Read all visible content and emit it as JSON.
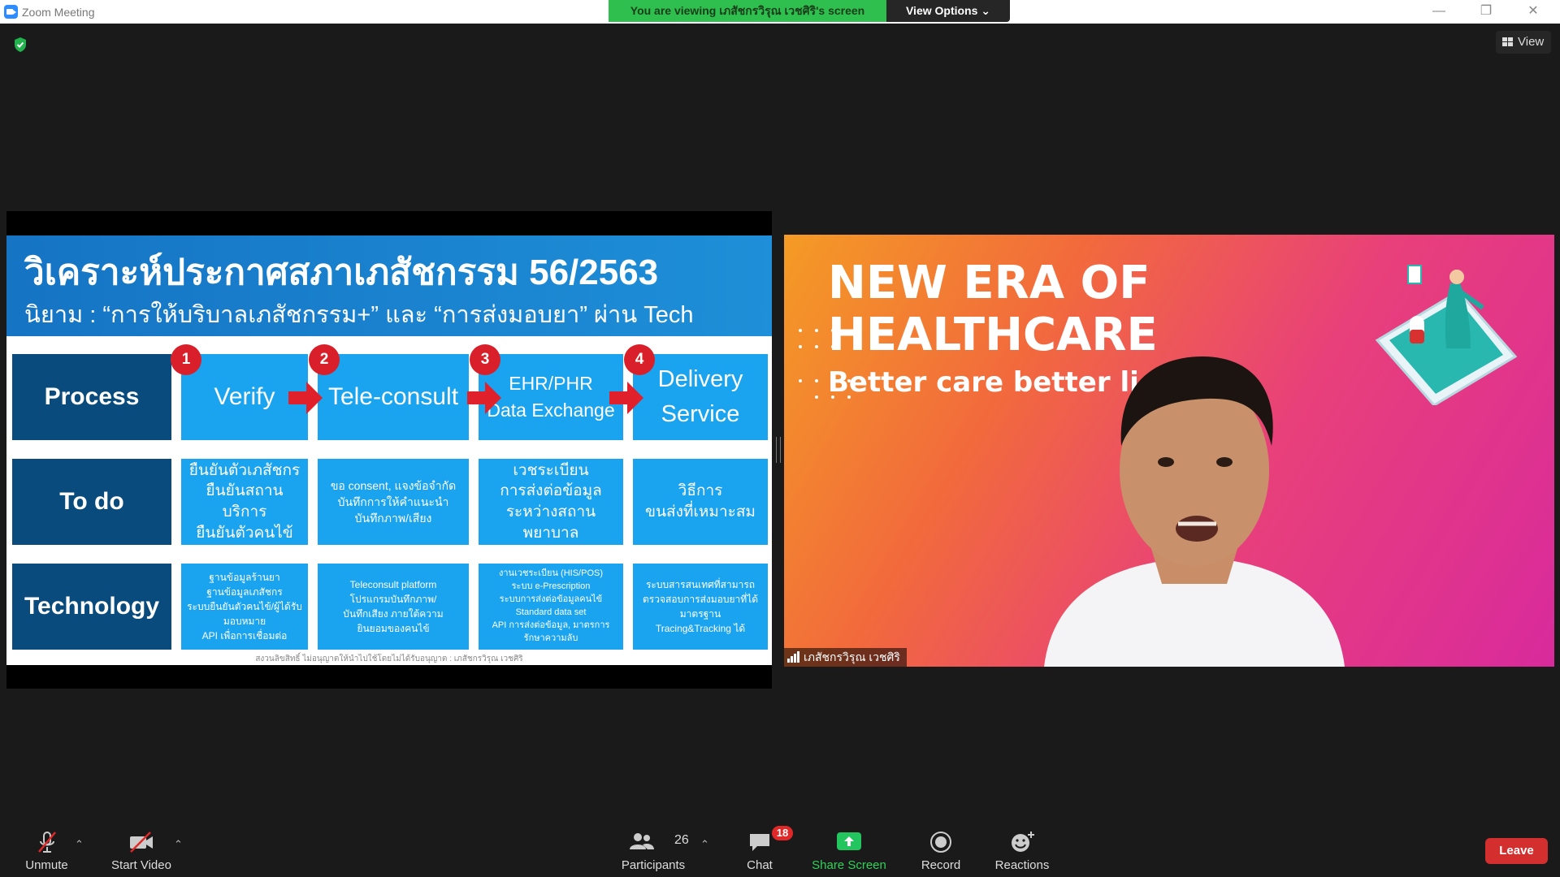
{
  "window": {
    "title": "Zoom Meeting",
    "viewing_banner": "You are viewing เภสัชกรวิรุณ เวชศิริ's screen",
    "view_options": "View Options ⌄",
    "view_button": "View"
  },
  "slide": {
    "title": "วิเคราะห์ประกาศสภาเภสัชกรรม 56/2563",
    "subtitle": "นิยาม : “การให้บริบาลเภสัชกรรม+” และ “การส่งมอบยา” ผ่าน Tech",
    "rows": {
      "process": "Process",
      "todo": "To do",
      "technology": "Technology"
    },
    "steps": [
      {
        "num": "1",
        "label": "Verify"
      },
      {
        "num": "2",
        "label": "Tele-consult"
      },
      {
        "num": "3",
        "label_line1": "EHR/PHR",
        "label_line2": "Data Exchange"
      },
      {
        "num": "4",
        "label_line1": "Delivery",
        "label_line2": "Service"
      }
    ],
    "todo": [
      [
        "ยืนยันตัวเภสัชกร",
        "ยืนยันสถานบริการ",
        "ยืนยันตัวคนไข้"
      ],
      [
        "ขอ consent, แจงข้อจำกัด",
        "บันทึกการให้คำแนะนำ",
        "บันทึกภาพ/เสียง"
      ],
      [
        "เวชระเบียน",
        "การส่งต่อข้อมูล",
        "ระหว่างสถานพยาบาล"
      ],
      [
        "วิธีการ",
        "ขนส่งที่เหมาะสม"
      ]
    ],
    "technology": [
      [
        "ฐานข้อมูลร้านยา",
        "ฐานข้อมูลเภสัชกร",
        "ระบบยืนยันตัวคนไข้/ผู้ได้รับมอบหมาย",
        "API เพื่อการเชื่อมต่อ"
      ],
      [
        "Teleconsult platform",
        "โปรแกรมบันทึกภาพ/",
        "บันทึกเสียง ภายใต้ความ",
        "ยินยอมของคนไข้"
      ],
      [
        "งานเวชระเบียน (HIS/POS)",
        "ระบบ e-Prescription",
        "ระบบการส่งต่อข้อมูลคนไข้",
        "Standard data set",
        "API การส่งต่อข้อมูล, มาตรการ",
        "รักษาความลับ"
      ],
      [
        "ระบบสารสนเทศที่สามารถ",
        "ตรวจสอบการส่งมอบยาที่ได้",
        "มาตรฐาน",
        "Tracing&Tracking ได้"
      ]
    ],
    "footnote": "สงวนลิขสิทธิ์ ไม่อนุญาตให้นำไปใช้โดยไม่ได้รับอนุญาต : เภสัชกรวิรุณ เวชศิริ"
  },
  "video": {
    "headline_line1": "NEW ERA OF",
    "headline_line2": "HEALTHCARE",
    "tagline": "Better care better li",
    "participant_name": "เภสัชกรวิรุณ เวชศิริ"
  },
  "toolbar": {
    "unmute": "Unmute",
    "start_video": "Start Video",
    "participants": "Participants",
    "participants_count": "26",
    "chat": "Chat",
    "chat_badge": "18",
    "share_screen": "Share Screen",
    "record": "Record",
    "reactions": "Reactions",
    "leave": "Leave"
  },
  "colors": {
    "banner_green": "#2fbf4f",
    "slide_blue": "#1aa3ef",
    "slide_navy": "#0a4b7d",
    "badge_red": "#d9202a",
    "leave_red": "#d32f2f"
  }
}
